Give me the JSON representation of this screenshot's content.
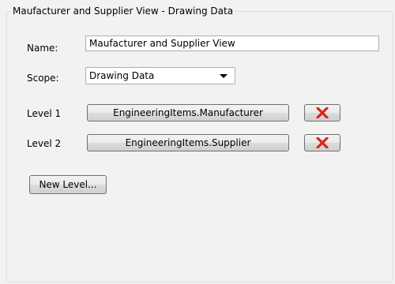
{
  "group": {
    "title": "Maufacturer and Supplier View - Drawing Data"
  },
  "name": {
    "label": "Name:",
    "value": "Maufacturer and Supplier View"
  },
  "scope": {
    "label": "Scope:",
    "selected": "Drawing Data"
  },
  "levels": [
    {
      "label": "Level 1",
      "button": "EngineeringItems.Manufacturer"
    },
    {
      "label": "Level 2",
      "button": "EngineeringItems.Supplier"
    }
  ],
  "new_level_button": "New Level...",
  "colors": {
    "delete_x": "#d9261c"
  }
}
